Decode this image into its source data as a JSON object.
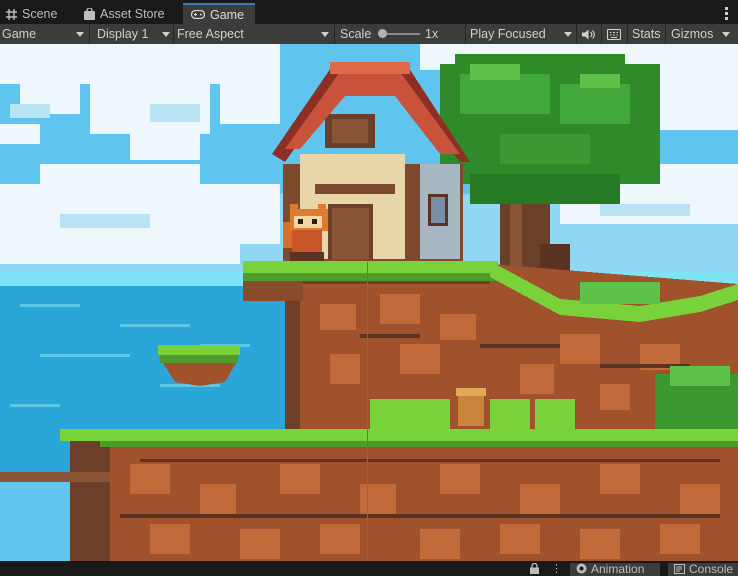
{
  "tabs": [
    {
      "label": "Scene",
      "icon": "grid-icon"
    },
    {
      "label": "Asset Store",
      "icon": "shopping-bag-icon"
    },
    {
      "label": "Game",
      "icon": "gamepad-icon",
      "active": true
    }
  ],
  "toolbar": {
    "view_select": "Game",
    "display_select": "Display 1",
    "aspect_select": "Free Aspect",
    "scale_label": "Scale",
    "scale_value": "1x",
    "play_mode_select": "Play Focused",
    "stats_label": "Stats",
    "gizmos_label": "Gizmos"
  },
  "statusbar": {
    "animation_label": "Animation",
    "console_label": "Console"
  },
  "colors": {
    "accent_tab_border": "#3a79bb",
    "toolbar_bg": "#3c3c3c",
    "window_bg": "#191919",
    "sky": "#5fc4ee",
    "sea": "#2aa6d8",
    "grass": "#7ad23b",
    "dirt": "#a0522d"
  }
}
